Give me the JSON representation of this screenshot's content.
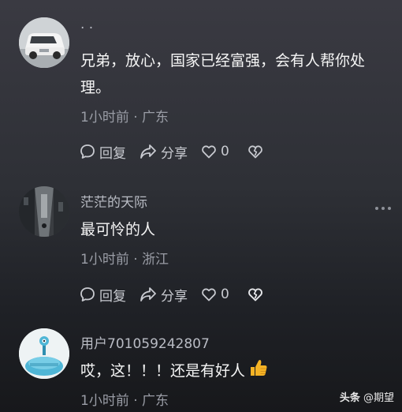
{
  "comments": [
    {
      "username": "· ·",
      "content": "兄弟，放心，国家已经富强，会有人帮你处理。",
      "time_location": "1小时前 · 广东",
      "reply_label": "回复",
      "share_label": "分享",
      "like_count": "0",
      "avatar_icon": "car-avatar"
    },
    {
      "username": "茫茫的天际",
      "content": "最可怜的人",
      "time_location": "1小时前 · 浙江",
      "reply_label": "回复",
      "share_label": "分享",
      "like_count": "0",
      "avatar_icon": "alley-photo-avatar"
    },
    {
      "username": "用户701059242807",
      "content": "哎，这！！！还是有好人",
      "content_emoji": "thumbs-up-emoji",
      "time_location": "1小时前 · 广东",
      "avatar_icon": "blue-cartoon-avatar"
    }
  ],
  "watermark": {
    "brand": "头条",
    "handle": "@期望"
  },
  "colors": {
    "text_primary": "#f5f5f5",
    "text_secondary": "#9a9da6",
    "username": "#b9bcc4",
    "thumb_emoji": "#f5b325"
  }
}
